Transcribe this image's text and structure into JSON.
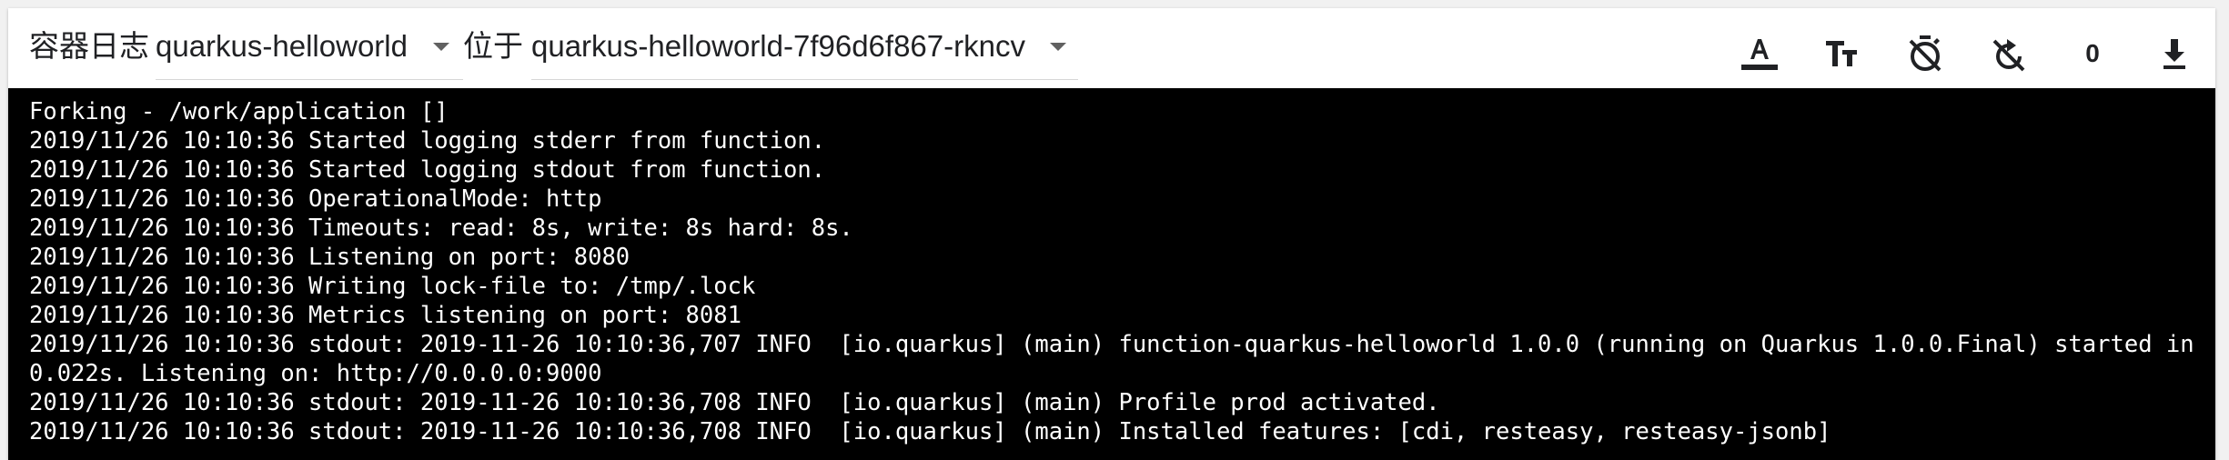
{
  "toolbar": {
    "logs_label": "容器日志",
    "container_select": {
      "value": "quarkus-helloworld"
    },
    "in_label": "位于",
    "pod_select": {
      "value": "quarkus-helloworld-7f96d6f867-rkncv"
    },
    "icons": [
      "text-color-icon",
      "text-size-icon",
      "timer-off-icon",
      "auto-refresh-off-icon",
      "download-icon"
    ],
    "line_count": "0"
  },
  "log": {
    "lines": [
      "Forking - /work/application []",
      "2019/11/26 10:10:36 Started logging stderr from function.",
      "2019/11/26 10:10:36 Started logging stdout from function.",
      "2019/11/26 10:10:36 OperationalMode: http",
      "2019/11/26 10:10:36 Timeouts: read: 8s, write: 8s hard: 8s.",
      "2019/11/26 10:10:36 Listening on port: 8080",
      "2019/11/26 10:10:36 Writing lock-file to: /tmp/.lock",
      "2019/11/26 10:10:36 Metrics listening on port: 8081",
      "2019/11/26 10:10:36 stdout: 2019-11-26 10:10:36,707 INFO  [io.quarkus] (main) function-quarkus-helloworld 1.0.0 (running on Quarkus 1.0.0.Final) started in",
      "0.022s. Listening on: http://0.0.0.0:9000",
      "2019/11/26 10:10:36 stdout: 2019-11-26 10:10:36,708 INFO  [io.quarkus] (main) Profile prod activated.",
      "2019/11/26 10:10:36 stdout: 2019-11-26 10:10:36,708 INFO  [io.quarkus] (main) Installed features: [cdi, resteasy, resteasy-jsonb]"
    ],
    "background": "#000000",
    "text_color": "#ffffff"
  }
}
